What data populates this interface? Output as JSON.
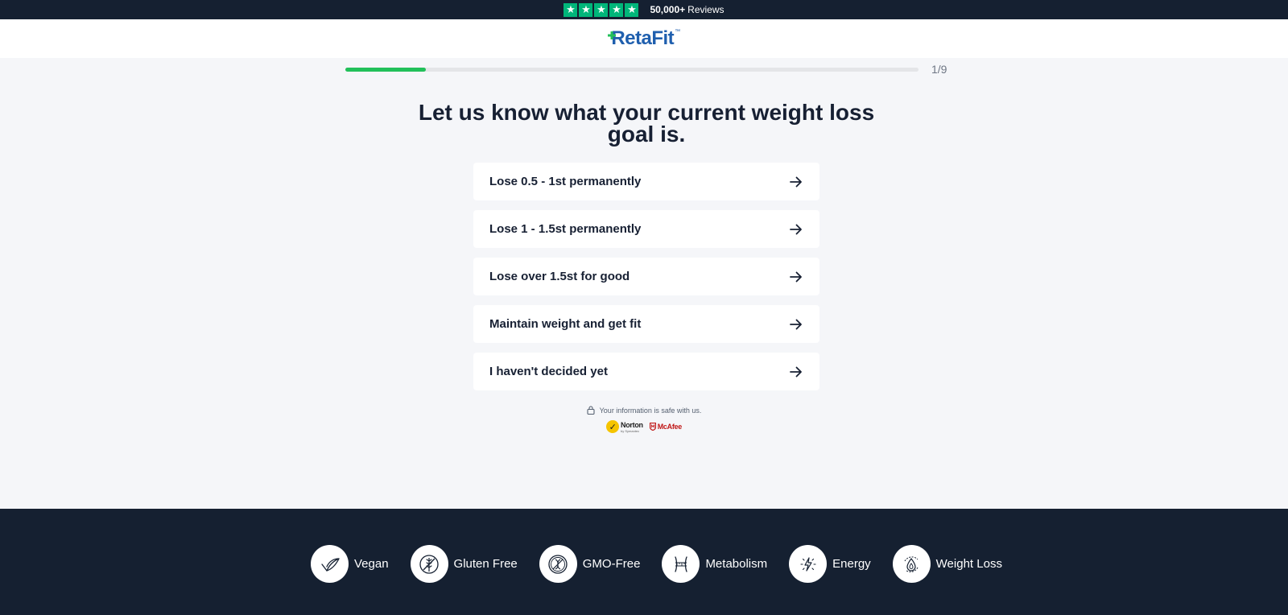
{
  "topbar": {
    "rating_stars": 5,
    "reviews_count": "50,000+",
    "reviews_label": "Reviews"
  },
  "brand": {
    "name": "RetaFit",
    "tm": "™",
    "color": "#1f5fae"
  },
  "progress": {
    "current": 1,
    "total": 9,
    "fraction": 0.14,
    "label": "1/9",
    "color": "#22c05a"
  },
  "question": {
    "title": "Let us know what your current weight loss goal is."
  },
  "options": [
    {
      "label": "Lose 0.5 - 1st permanently"
    },
    {
      "label": "Lose 1 - 1.5st permanently"
    },
    {
      "label": "Lose over 1.5st for good"
    },
    {
      "label": "Maintain weight and get fit"
    },
    {
      "label": "I haven't decided yet"
    }
  ],
  "security": {
    "text": "Your information is safe with us.",
    "badges": [
      "Norton",
      "McAfee"
    ],
    "norton_sub": "by Symantec"
  },
  "features": [
    {
      "label": "Vegan",
      "icon": "leaf-icon"
    },
    {
      "label": "Gluten Free",
      "icon": "wheat-crossed-icon"
    },
    {
      "label": "GMO-Free",
      "icon": "gmo-free-icon"
    },
    {
      "label": "Metabolism",
      "icon": "waist-icon"
    },
    {
      "label": "Energy",
      "icon": "lightning-icon"
    },
    {
      "label": "Weight Loss",
      "icon": "fat-burn-icon"
    }
  ],
  "colors": {
    "dark_navy": "#152031",
    "background": "#f5f6f9",
    "trustpilot_green": "#00b67a"
  }
}
